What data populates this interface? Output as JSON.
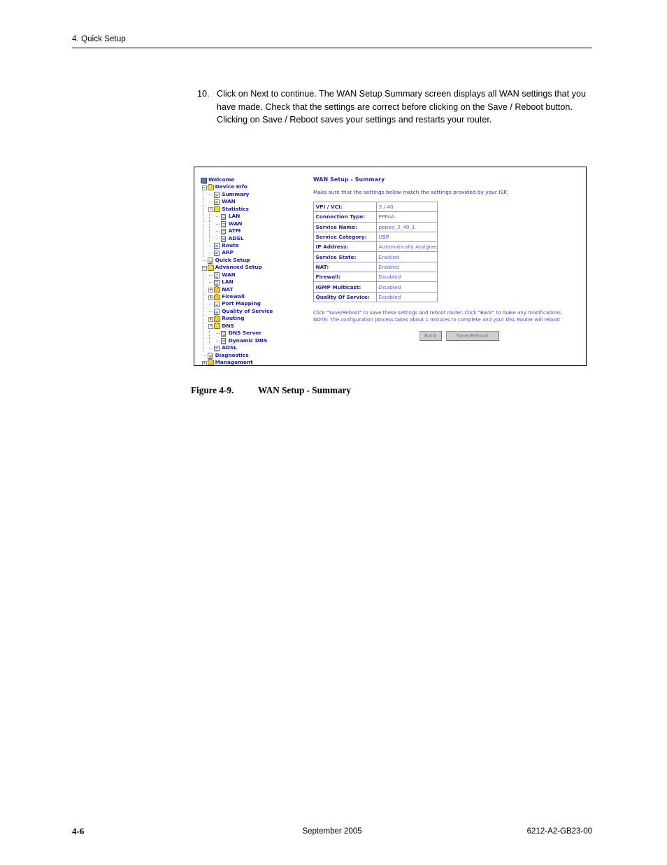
{
  "page": {
    "running_header": "4. Quick Setup",
    "footer": {
      "page_number": "4-6",
      "date": "September 2005",
      "doc_number": "6212-A2-GB23-00"
    }
  },
  "step": {
    "number": "10.",
    "text": "Click on Next to continue. The WAN Setup Summary screen displays all WAN settings that you have made. Check that the settings are correct before clicking on the Save / Reboot button. Clicking on Save / Reboot saves your settings and restarts your router."
  },
  "figure": {
    "caption_number": "Figure 4-9.",
    "caption_text": "WAN Setup - Summary"
  },
  "ui": {
    "nav_tree": [
      {
        "label": "Welcome",
        "indent": 0,
        "icon": "monitor-icon",
        "expander": "",
        "guides": []
      },
      {
        "label": "Device Info",
        "indent": 1,
        "icon": "folder-open-icon",
        "expander": "-",
        "guides": []
      },
      {
        "label": "Summary",
        "indent": 2,
        "icon": "page-icon",
        "expander": "",
        "guides": [
          0
        ]
      },
      {
        "label": "WAN",
        "indent": 2,
        "icon": "page-icon",
        "expander": "",
        "guides": [
          0
        ]
      },
      {
        "label": "Statistics",
        "indent": 2,
        "icon": "folder-open-icon",
        "expander": "-",
        "guides": [
          0
        ]
      },
      {
        "label": "LAN",
        "indent": 3,
        "icon": "page-icon",
        "expander": "",
        "guides": [
          0,
          1
        ]
      },
      {
        "label": "WAN",
        "indent": 3,
        "icon": "page-icon",
        "expander": "",
        "guides": [
          0,
          1
        ]
      },
      {
        "label": "ATM",
        "indent": 3,
        "icon": "page-icon",
        "expander": "",
        "guides": [
          0,
          1
        ]
      },
      {
        "label": "ADSL",
        "indent": 3,
        "icon": "page-icon",
        "expander": "",
        "guides": [
          0,
          1
        ]
      },
      {
        "label": "Route",
        "indent": 2,
        "icon": "page-icon",
        "expander": "",
        "guides": [
          0
        ]
      },
      {
        "label": "ARP",
        "indent": 2,
        "icon": "page-icon",
        "expander": "",
        "guides": [
          0
        ]
      },
      {
        "label": "Quick Setup",
        "indent": 1,
        "icon": "page-icon",
        "expander": "",
        "guides": []
      },
      {
        "label": "Advanced Setup",
        "indent": 1,
        "icon": "folder-open-icon",
        "expander": "-",
        "guides": []
      },
      {
        "label": "WAN",
        "indent": 2,
        "icon": "page-icon",
        "expander": "",
        "guides": [
          0
        ]
      },
      {
        "label": "LAN",
        "indent": 2,
        "icon": "page-icon",
        "expander": "",
        "guides": [
          0
        ]
      },
      {
        "label": "NAT",
        "indent": 2,
        "icon": "folder-closed-icon",
        "expander": "+",
        "guides": [
          0
        ]
      },
      {
        "label": "Firewall",
        "indent": 2,
        "icon": "folder-closed-icon",
        "expander": "+",
        "guides": [
          0
        ]
      },
      {
        "label": "Port Mapping",
        "indent": 2,
        "icon": "page-icon",
        "expander": "",
        "guides": [
          0
        ]
      },
      {
        "label": "Quality of Service",
        "indent": 2,
        "icon": "page-icon",
        "expander": "",
        "guides": [
          0
        ]
      },
      {
        "label": "Routing",
        "indent": 2,
        "icon": "folder-closed-icon",
        "expander": "+",
        "guides": [
          0
        ]
      },
      {
        "label": "DNS",
        "indent": 2,
        "icon": "folder-open-icon",
        "expander": "-",
        "guides": [
          0
        ]
      },
      {
        "label": "DNS Server",
        "indent": 3,
        "icon": "page-icon",
        "expander": "",
        "guides": [
          0,
          1
        ]
      },
      {
        "label": "Dynamic DNS",
        "indent": 3,
        "icon": "page-icon",
        "expander": "",
        "guides": [
          0,
          1
        ]
      },
      {
        "label": "ADSL",
        "indent": 2,
        "icon": "page-icon",
        "expander": "",
        "guides": [
          0
        ]
      },
      {
        "label": "Diagnostics",
        "indent": 1,
        "icon": "page-icon",
        "expander": "",
        "guides": []
      },
      {
        "label": "Management",
        "indent": 1,
        "icon": "folder-closed-icon",
        "expander": "+",
        "guides": []
      }
    ],
    "content": {
      "title": "WAN Setup - Summary",
      "subtitle": "Make sure that the settings below match the settings provided by your ISP.",
      "summary_rows": [
        {
          "key": "VPI / VCI:",
          "value": "3 / 40"
        },
        {
          "key": "Connection Type:",
          "value": "PPPoA"
        },
        {
          "key": "Service Name:",
          "value": "pppoa_3_40_1"
        },
        {
          "key": "Service Category:",
          "value": "UBR"
        },
        {
          "key": "IP Address:",
          "value": "Automatically Assigned"
        },
        {
          "key": "Service State:",
          "value": "Enabled"
        },
        {
          "key": "NAT:",
          "value": "Enabled"
        },
        {
          "key": "Firewall:",
          "value": "Disabled"
        },
        {
          "key": "IGMP Multicast:",
          "value": "Disabled"
        },
        {
          "key": "Quality Of Service:",
          "value": "Disabled"
        }
      ],
      "note_line1": "Click \"Save/Reboot\" to save these settings and reboot router. Click \"Back\" to make any modifications.",
      "note_line2": "NOTE: The configuration process takes about 1 minutes to complete and your DSL Router will reboot",
      "buttons": {
        "back": "Back",
        "save_reboot": "Save/Reboot"
      }
    },
    "colors": {
      "link_blue": "#1b1bb4",
      "text_blue": "#3232b0",
      "value_blue": "#5c5cc8",
      "folder_open": "#e9dd46",
      "folder_closed": "#f3c33c",
      "button_face": "#d2cfc8"
    }
  }
}
